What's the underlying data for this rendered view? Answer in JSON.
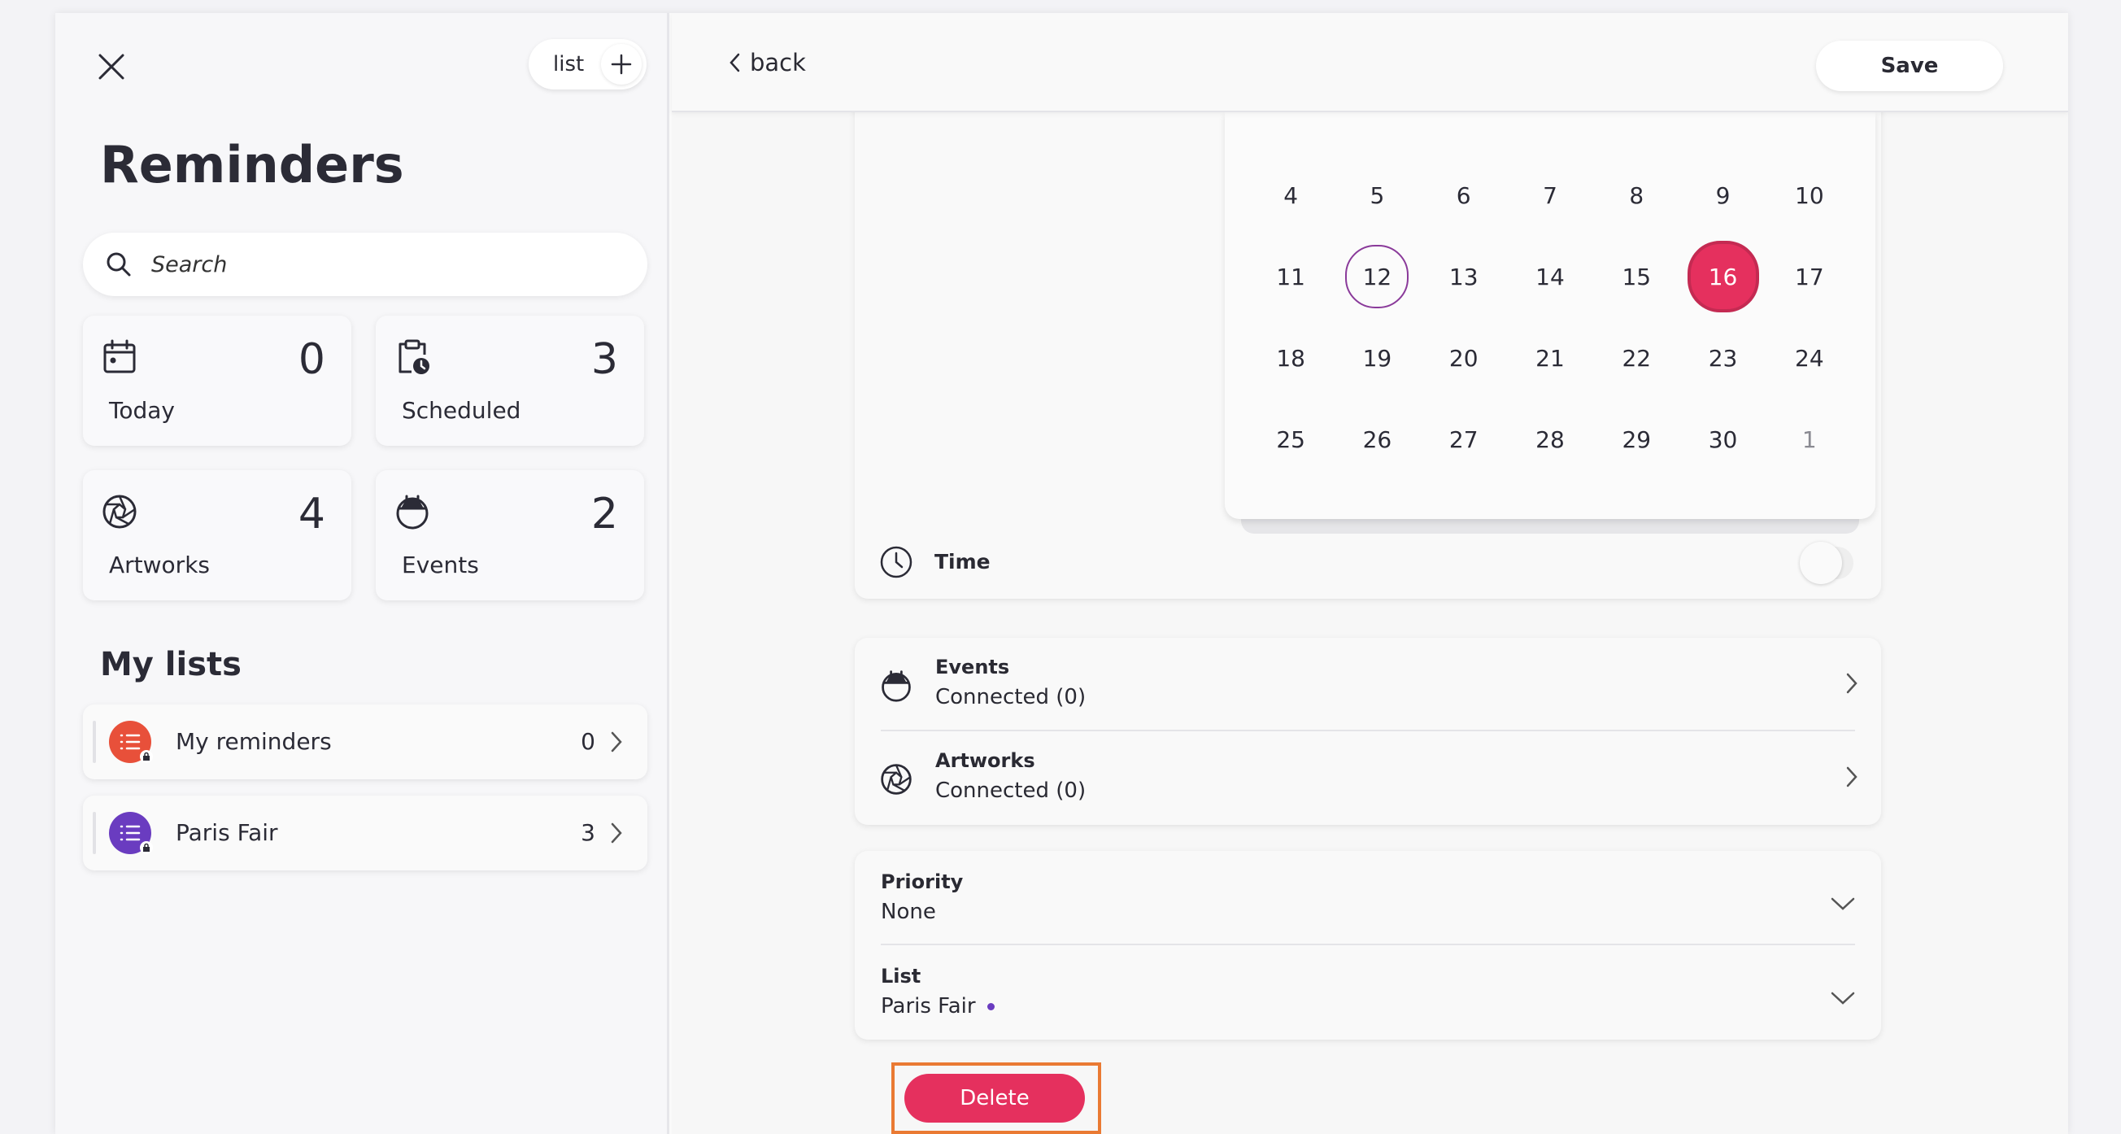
{
  "colors": {
    "accent": "#e5305e",
    "today_ring": "#8a3a9a",
    "my_reminders": "#e8503a",
    "paris_fair": "#6a3cc0",
    "highlight": "#ea7a33"
  },
  "sidebar": {
    "title": "Reminders",
    "list_button": "list",
    "search_placeholder": "Search",
    "tiles": [
      {
        "label": "Today",
        "count": "0",
        "icon": "calendar-icon"
      },
      {
        "label": "Scheduled",
        "count": "3",
        "icon": "clipboard-clock-icon"
      },
      {
        "label": "Artworks",
        "count": "4",
        "icon": "aperture-icon"
      },
      {
        "label": "Events",
        "count": "2",
        "icon": "event-icon"
      }
    ],
    "my_lists_title": "My lists",
    "lists": [
      {
        "name": "My reminders",
        "count": "0",
        "color": "#e8503a"
      },
      {
        "name": "Paris Fair",
        "count": "3",
        "color": "#6a3cc0"
      }
    ]
  },
  "topbar": {
    "back": "back",
    "save": "Save"
  },
  "calendar": {
    "weeks": [
      [
        "4",
        "5",
        "6",
        "7",
        "8",
        "9",
        "10"
      ],
      [
        "11",
        "12",
        "13",
        "14",
        "15",
        "16",
        "17"
      ],
      [
        "18",
        "19",
        "20",
        "21",
        "22",
        "23",
        "24"
      ],
      [
        "25",
        "26",
        "27",
        "28",
        "29",
        "30",
        "1"
      ]
    ],
    "today": "12",
    "selected": "16"
  },
  "time": {
    "label": "Time",
    "enabled": false
  },
  "connections": [
    {
      "title": "Events",
      "status": "Connected (0)",
      "icon": "event-icon"
    },
    {
      "title": "Artworks",
      "status": "Connected (0)",
      "icon": "aperture-icon"
    }
  ],
  "priority": {
    "label": "Priority",
    "value": "None"
  },
  "list_select": {
    "label": "List",
    "value": "Paris Fair"
  },
  "delete": "Delete"
}
